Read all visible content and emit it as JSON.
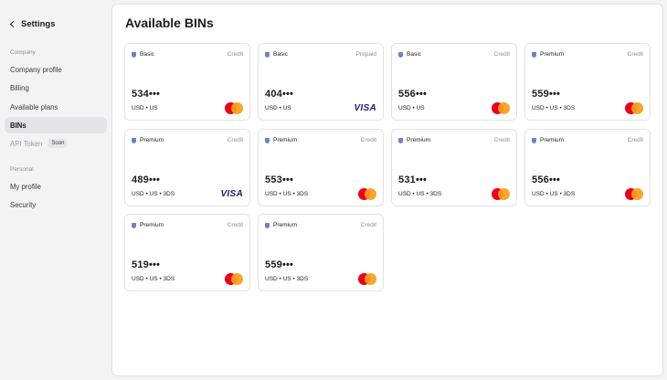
{
  "sidebar": {
    "back_label": "Settings",
    "company_label": "Company",
    "items": [
      {
        "label": "Company profile"
      },
      {
        "label": "Billing"
      },
      {
        "label": "Available plans"
      },
      {
        "label": "BINs"
      },
      {
        "label": "API Token",
        "badge": "Soon"
      }
    ],
    "personal_label": "Personal",
    "personal_items": [
      {
        "label": "My profile"
      },
      {
        "label": "Security"
      }
    ]
  },
  "main": {
    "title": "Available BINs",
    "cards": [
      {
        "tier": "Basic",
        "type": "Credit",
        "bin": "534•••",
        "meta": "USD • US",
        "network": "mastercard"
      },
      {
        "tier": "Basic",
        "type": "Prepaid",
        "bin": "404•••",
        "meta": "USD • US",
        "network": "visa",
        "network_label": "VISA"
      },
      {
        "tier": "Basic",
        "type": "Credit",
        "bin": "556•••",
        "meta": "USD • US",
        "network": "mastercard"
      },
      {
        "tier": "Premium",
        "type": "Credit",
        "bin": "559•••",
        "meta": "USD • US • 3DS",
        "network": "mastercard"
      },
      {
        "tier": "Premium",
        "type": "Credit",
        "bin": "489•••",
        "meta": "USD • US • 3DS",
        "network": "visa",
        "network_label": "VISA"
      },
      {
        "tier": "Premium",
        "type": "Credit",
        "bin": "553•••",
        "meta": "USD • US • 3DS",
        "network": "mastercard"
      },
      {
        "tier": "Premium",
        "type": "Credit",
        "bin": "531•••",
        "meta": "USD • US • 3DS",
        "network": "mastercard"
      },
      {
        "tier": "Premium",
        "type": "Credit",
        "bin": "556•••",
        "meta": "USD • US • 3DS",
        "network": "mastercard"
      },
      {
        "tier": "Premium",
        "type": "Credit",
        "bin": "519•••",
        "meta": "USD • US • 3DS",
        "network": "mastercard"
      },
      {
        "tier": "Premium",
        "type": "Credit",
        "bin": "559•••",
        "meta": "USD • US • 3DS",
        "network": "mastercard"
      }
    ]
  },
  "colors": {
    "accent_shield": "#6b84c4",
    "mastercard_red": "#eb001b",
    "mastercard_orange": "#f79e1b",
    "visa_blue": "#1a1f71"
  }
}
